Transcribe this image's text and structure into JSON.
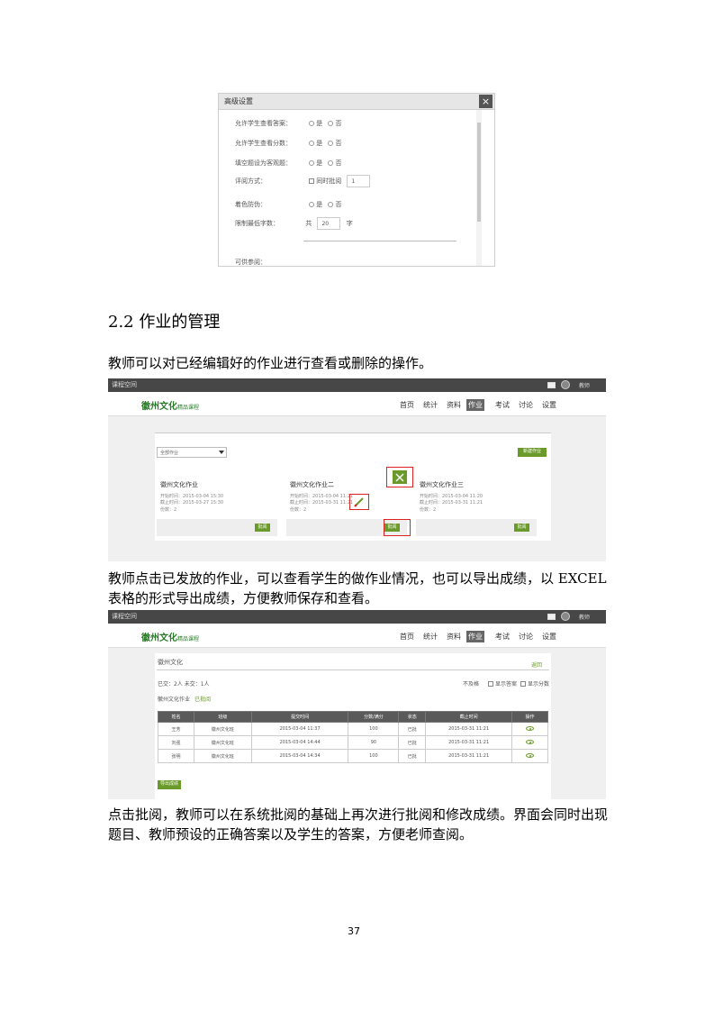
{
  "dialog": {
    "title": "高级设置",
    "close": "×",
    "rows": [
      {
        "label": "允许学生查看答案：",
        "opt1": "是",
        "opt2": "否"
      },
      {
        "label": "允许学生查看分数：",
        "opt1": "是",
        "opt2": "否"
      },
      {
        "label": "填空题设为客观题：",
        "opt1": "是",
        "opt2": "否"
      },
      {
        "label": "评阅方式：",
        "check": "同时批阅",
        "box": "1"
      },
      {
        "label": "着色防伪：",
        "opt1": "是",
        "opt2": "否"
      },
      {
        "label": "限制最低字数：",
        "pre": "共",
        "box": "20",
        "post": "字"
      },
      {
        "label": "可供参阅："
      }
    ]
  },
  "section": {
    "heading": "2.2 作业的管理",
    "p1": "教师可以对已经编辑好的作业进行查看或删除的操作。",
    "p2": "教师点击已发放的作业，可以查看学生的做作业情况，也可以导出成绩，以 EXCEL 表格的形式导出成绩，方便教师保存和查看。",
    "p3": "点击批阅，教师可以在系统批阅的基础上再次进行批阅和修改成绩。界面会同时出现题目、教师预设的正确答案以及学生的答案，方便老师查阅。"
  },
  "app": {
    "topbar_title": "课程空间",
    "user": "教师",
    "logo": "徽州文化",
    "logo_sub": "精品课程",
    "nav": [
      "首页",
      "统计",
      "资料",
      "作业",
      "考试",
      "讨论",
      "设置"
    ],
    "active_nav": "作业"
  },
  "hw_list": {
    "filter": "全部作业",
    "new_button": "新建作业",
    "cards": [
      {
        "title": "徽州文化作业",
        "start": "开始时间：2015-03-04 15:30",
        "end": "截止时间：2015-03-27 15:30",
        "count": "份数：2",
        "btn": "批阅"
      },
      {
        "title": "徽州文化作业二",
        "start": "开始时间：2015-03-04 11:21",
        "end": "截止时间：2015-03-31 11:21",
        "count": "份数：2",
        "btn": "批阅"
      },
      {
        "title": "徽州文化作业三",
        "start": "开始时间：2015-03-04 11:20",
        "end": "截止时间：2015-03-31 11:21",
        "count": "份数：2",
        "btn": "批阅"
      }
    ]
  },
  "grades": {
    "title": "徽州文化",
    "back": "返回",
    "stats": "已交：2人  未交：1人",
    "legend1": "不及格",
    "legend2": "显示答案",
    "legend3": "显示分数",
    "tab1": "徽州文化作业",
    "tab2": "已批阅",
    "headers": [
      "姓名",
      "班级",
      "提交时间",
      "分数/满分",
      "状态",
      "截止时间",
      "操作"
    ],
    "rows": [
      [
        "王芳",
        "徽州文化班",
        "2015-03-04 11:37",
        "100",
        "已批",
        "2015-03-31 11:21"
      ],
      [
        "刘强",
        "徽州文化班",
        "2015-03-04 14:44",
        "90",
        "已批",
        "2015-03-31 11:21"
      ],
      [
        "张明",
        "徽州文化班",
        "2015-03-04 14:34",
        "100",
        "已批",
        "2015-03-31 11:21"
      ]
    ],
    "export": "导出成绩"
  },
  "page_number": "37"
}
